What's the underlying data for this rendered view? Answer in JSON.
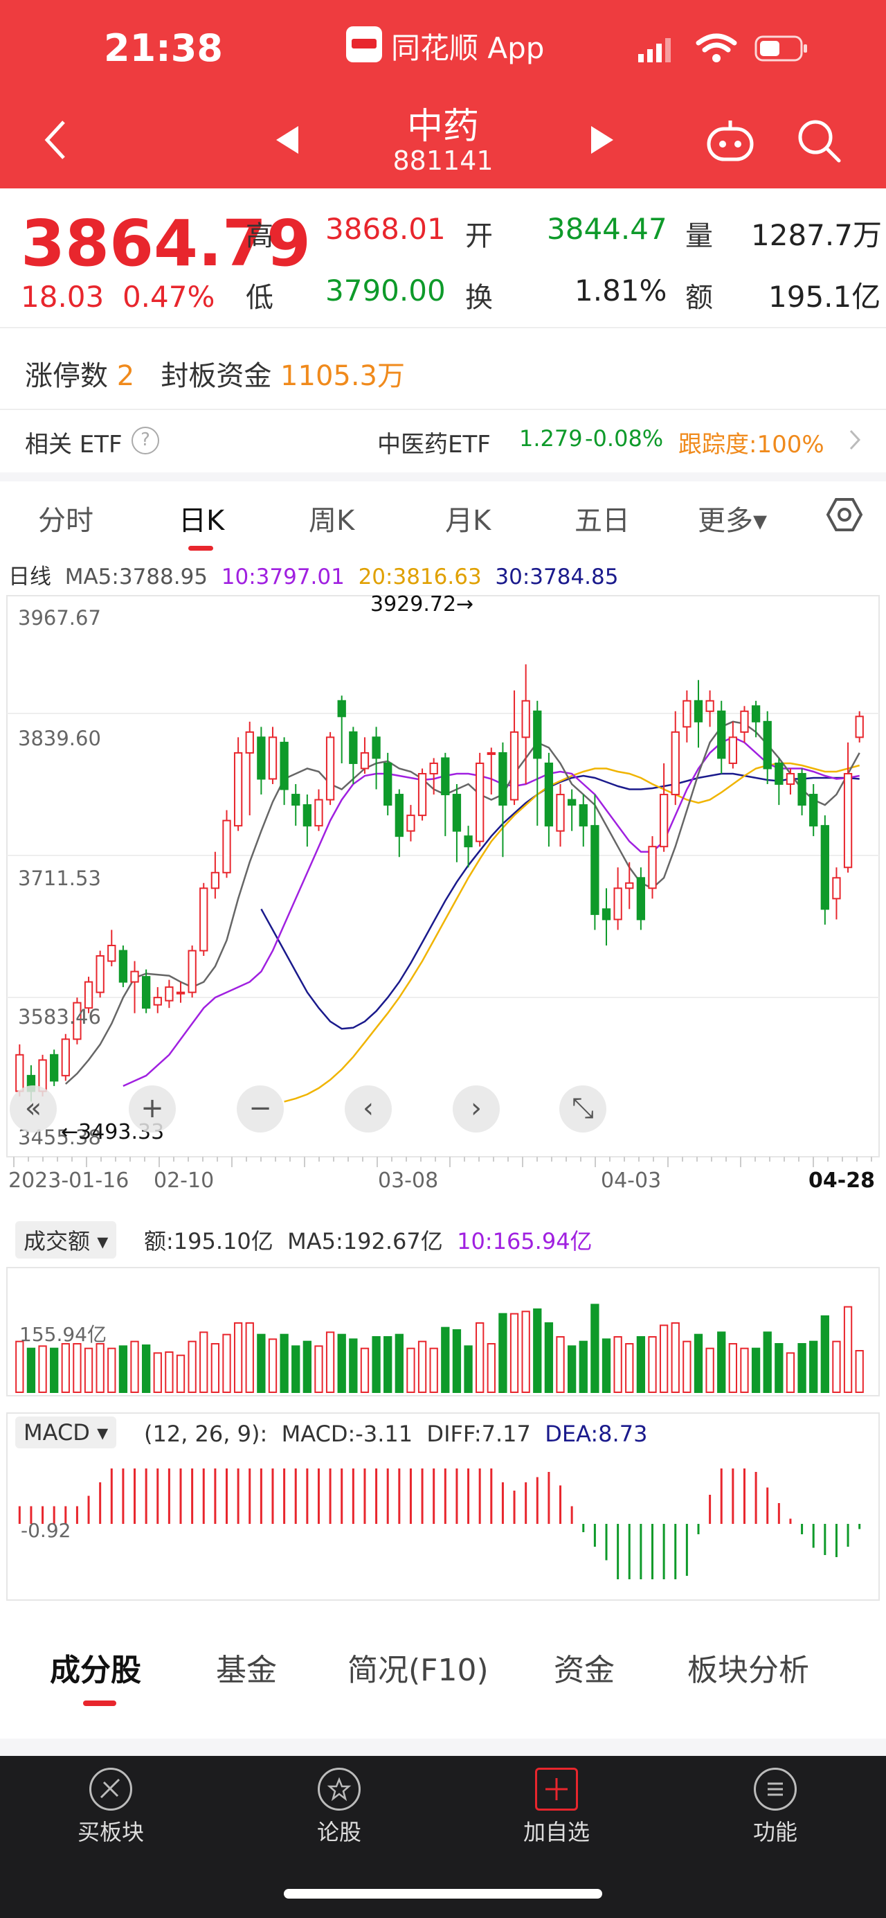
{
  "status_bar": {
    "time": "21:38",
    "app_name": "同花顺 App"
  },
  "header": {
    "title": "中药",
    "code": "881141"
  },
  "quote": {
    "price": "3864.79",
    "change": "18.03",
    "change_pct": "0.47%",
    "high_label": "高",
    "high": "3868.01",
    "open_label": "开",
    "open": "3844.47",
    "volume_label": "量",
    "volume": "1287.7万",
    "low_label": "低",
    "low": "3790.00",
    "turnover_label": "换",
    "turnover": "1.81%",
    "amount_label": "额",
    "amount": "195.1亿",
    "limit_up_label": "涨停数",
    "limit_up": "2",
    "seal_label": "封板资金",
    "seal": "1105.3万",
    "etf_label": "相关 ETF",
    "etf_name": "中医药ETF",
    "etf_price": "1.279",
    "etf_change": "-0.08%",
    "etf_tracking": "跟踪度:100%"
  },
  "tabs": [
    "分时",
    "日K",
    "周K",
    "月K",
    "五日",
    "更多▾"
  ],
  "ma_bar": {
    "label": "日线",
    "ma5": "MA5:3788.95",
    "ma10": "10:3797.01",
    "ma20": "20:3816.63",
    "ma30": "30:3784.85"
  },
  "price_axis": {
    "t1": "3967.67",
    "t2": "3839.60",
    "t3": "3711.53",
    "t4": "3583.46",
    "t5": "3455.38"
  },
  "annotations": {
    "high": "3929.72→",
    "low": "←3493.33"
  },
  "date_axis": [
    "2023-01-16",
    "02-10",
    "03-08",
    "04-03",
    "04-28"
  ],
  "volume_bar": {
    "select": "成交额",
    "amount": "额:195.10亿",
    "ma5": "MA5:192.67亿",
    "ma10": "10:165.94亿",
    "axis": "155.94亿"
  },
  "macd_bar": {
    "select": "MACD",
    "params": "(12, 26, 9):",
    "macd": "MACD:-3.11",
    "diff": "DIFF:7.17",
    "dea": "DEA:8.73",
    "axis": "-0.92"
  },
  "bottom_tabs": [
    "成分股",
    "基金",
    "简况(F10)",
    "资金",
    "板块分析"
  ],
  "tab_bar": [
    {
      "label": "买板块",
      "icon": "buy-sector-icon"
    },
    {
      "label": "论股",
      "icon": "forum-icon"
    },
    {
      "label": "加自选",
      "icon": "add-watchlist-icon"
    },
    {
      "label": "功能",
      "icon": "menu-icon"
    }
  ],
  "colors": {
    "up": "#e8262d",
    "down": "#0e9a2a",
    "ma5": "#666666",
    "ma10": "#a020e0",
    "ma20": "#f0b400",
    "ma30": "#1a1a8c",
    "header": "#ee3c3f"
  },
  "chart_data": {
    "type": "candlestick",
    "ylim": [
      3455.38,
      3967.67
    ],
    "candles": [
      [
        3505,
        3540,
        3500,
        3550
      ],
      [
        3520,
        3505,
        3495,
        3530
      ],
      [
        3505,
        3535,
        3500,
        3540
      ],
      [
        3540,
        3515,
        3510,
        3545
      ],
      [
        3520,
        3555,
        3515,
        3560
      ],
      [
        3555,
        3590,
        3550,
        3595
      ],
      [
        3585,
        3610,
        3580,
        3615
      ],
      [
        3600,
        3635,
        3595,
        3640
      ],
      [
        3630,
        3645,
        3625,
        3660
      ],
      [
        3640,
        3610,
        3605,
        3645
      ],
      [
        3610,
        3620,
        3580,
        3630
      ],
      [
        3615,
        3585,
        3580,
        3622
      ],
      [
        3588,
        3595,
        3580,
        3605
      ],
      [
        3592,
        3605,
        3585,
        3612
      ],
      [
        3600,
        3600,
        3590,
        3610
      ],
      [
        3600,
        3640,
        3595,
        3645
      ],
      [
        3640,
        3700,
        3635,
        3705
      ],
      [
        3700,
        3715,
        3690,
        3735
      ],
      [
        3715,
        3765,
        3710,
        3775
      ],
      [
        3760,
        3830,
        3755,
        3845
      ],
      [
        3830,
        3850,
        3770,
        3860
      ],
      [
        3845,
        3805,
        3790,
        3855
      ],
      [
        3805,
        3845,
        3800,
        3855
      ],
      [
        3840,
        3795,
        3780,
        3845
      ],
      [
        3790,
        3780,
        3760,
        3800
      ],
      [
        3780,
        3760,
        3740,
        3790
      ],
      [
        3760,
        3785,
        3755,
        3795
      ],
      [
        3785,
        3845,
        3780,
        3850
      ],
      [
        3880,
        3865,
        3820,
        3885
      ],
      [
        3850,
        3820,
        3800,
        3855
      ],
      [
        3815,
        3830,
        3810,
        3845
      ],
      [
        3845,
        3825,
        3795,
        3855
      ],
      [
        3820,
        3780,
        3770,
        3830
      ],
      [
        3790,
        3750,
        3730,
        3795
      ],
      [
        3755,
        3770,
        3745,
        3780
      ],
      [
        3770,
        3810,
        3765,
        3815
      ],
      [
        3810,
        3820,
        3790,
        3825
      ],
      [
        3825,
        3790,
        3750,
        3830
      ],
      [
        3790,
        3755,
        3725,
        3800
      ],
      [
        3750,
        3740,
        3720,
        3760
      ],
      [
        3745,
        3820,
        3740,
        3830
      ],
      [
        3830,
        3830,
        3790,
        3835
      ],
      [
        3830,
        3780,
        3730,
        3840
      ],
      [
        3785,
        3850,
        3780,
        3890
      ],
      [
        3845,
        3880,
        3800,
        3915
      ],
      [
        3870,
        3825,
        3760,
        3880
      ],
      [
        3820,
        3760,
        3740,
        3830
      ],
      [
        3755,
        3790,
        3740,
        3800
      ],
      [
        3785,
        3780,
        3755,
        3795
      ],
      [
        3780,
        3760,
        3740,
        3790
      ],
      [
        3760,
        3675,
        3660,
        3790
      ],
      [
        3680,
        3670,
        3645,
        3700
      ],
      [
        3670,
        3700,
        3660,
        3720
      ],
      [
        3700,
        3705,
        3680,
        3725
      ],
      [
        3710,
        3670,
        3660,
        3720
      ],
      [
        3700,
        3740,
        3690,
        3750
      ],
      [
        3740,
        3790,
        3735,
        3820
      ],
      [
        3790,
        3850,
        3780,
        3870
      ],
      [
        3855,
        3880,
        3840,
        3890
      ],
      [
        3880,
        3860,
        3835,
        3900
      ],
      [
        3870,
        3880,
        3855,
        3890
      ],
      [
        3870,
        3825,
        3810,
        3880
      ],
      [
        3820,
        3845,
        3815,
        3860
      ],
      [
        3850,
        3870,
        3840,
        3875
      ],
      [
        3875,
        3860,
        3845,
        3880
      ],
      [
        3860,
        3815,
        3800,
        3870
      ],
      [
        3820,
        3800,
        3780,
        3825
      ],
      [
        3800,
        3810,
        3790,
        3815
      ],
      [
        3810,
        3780,
        3770,
        3815
      ],
      [
        3790,
        3760,
        3750,
        3800
      ],
      [
        3760,
        3680,
        3665,
        3770
      ],
      [
        3690,
        3710,
        3670,
        3720
      ],
      [
        3720,
        3810,
        3715,
        3840
      ],
      [
        3845,
        3865,
        3840,
        3870
      ]
    ],
    "ma5": [
      3512,
      3522,
      3535,
      3550,
      3570,
      3595,
      3614,
      3618,
      3617,
      3616,
      3610,
      3605,
      3610,
      3625,
      3650,
      3690,
      3725,
      3755,
      3783,
      3805,
      3810,
      3815,
      3812,
      3800,
      3795,
      3805,
      3815,
      3820,
      3822,
      3815,
      3812,
      3805,
      3795,
      3790,
      3795,
      3800,
      3790,
      3785,
      3790,
      3810,
      3825,
      3840,
      3835,
      3820,
      3800,
      3790,
      3780,
      3760,
      3740,
      3720,
      3705,
      3700,
      3710,
      3740,
      3775,
      3810,
      3840,
      3855,
      3860,
      3858,
      3850,
      3838,
      3825,
      3810,
      3795,
      3785,
      3780,
      3790,
      3810,
      3830
    ],
    "ma10": [
      3510,
      3515,
      3520,
      3530,
      3540,
      3555,
      3570,
      3585,
      3595,
      3600,
      3605,
      3610,
      3620,
      3640,
      3665,
      3690,
      3715,
      3740,
      3765,
      3785,
      3800,
      3808,
      3810,
      3810,
      3808,
      3806,
      3804,
      3805,
      3808,
      3810,
      3810,
      3808,
      3805,
      3800,
      3798,
      3800,
      3805,
      3810,
      3812,
      3810,
      3800,
      3790,
      3775,
      3760,
      3745,
      3735,
      3735,
      3745,
      3770,
      3795,
      3815,
      3830,
      3840,
      3845,
      3840,
      3830,
      3820,
      3815,
      3815,
      3815,
      3812,
      3808,
      3805,
      3806,
      3808
    ],
    "ma20": [
      3495,
      3498,
      3502,
      3508,
      3516,
      3526,
      3538,
      3552,
      3566,
      3580,
      3595,
      3612,
      3630,
      3650,
      3670,
      3690,
      3710,
      3728,
      3745,
      3758,
      3770,
      3780,
      3790,
      3798,
      3803,
      3808,
      3812,
      3815,
      3815,
      3812,
      3810,
      3806,
      3800,
      3795,
      3790,
      3785,
      3782,
      3785,
      3792,
      3800,
      3808,
      3815,
      3818,
      3820,
      3820,
      3818,
      3815,
      3812,
      3812,
      3815,
      3818
    ],
    "ma30": [
      3680,
      3660,
      3640,
      3620,
      3600,
      3585,
      3572,
      3565,
      3566,
      3572,
      3582,
      3595,
      3610,
      3628,
      3648,
      3668,
      3688,
      3706,
      3722,
      3736,
      3750,
      3762,
      3772,
      3782,
      3790,
      3797,
      3802,
      3806,
      3808,
      3806,
      3802,
      3798,
      3795,
      3795,
      3796,
      3798,
      3800,
      3803,
      3806,
      3808,
      3810,
      3810,
      3808,
      3806,
      3804,
      3803,
      3805,
      3805,
      3806,
      3806,
      3806,
      3806,
      3805
    ]
  }
}
